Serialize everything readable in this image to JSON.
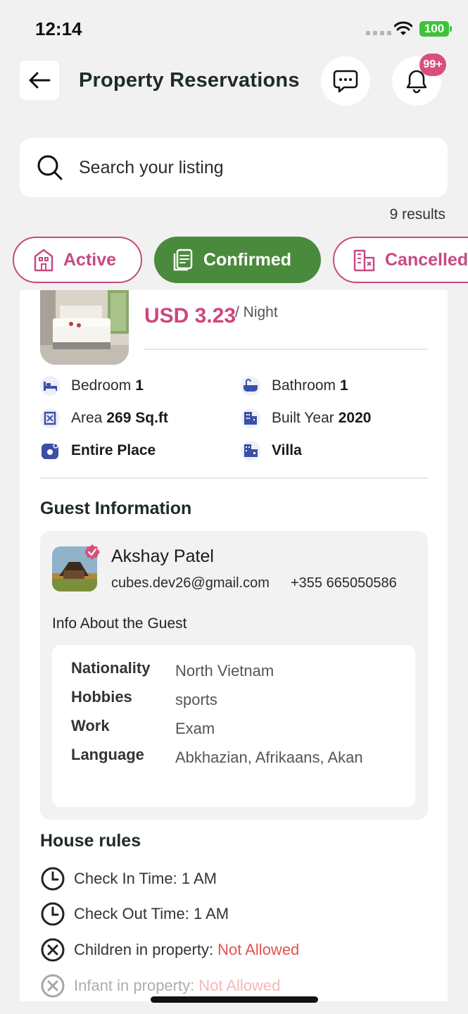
{
  "status_bar": {
    "time": "12:14",
    "battery": "100"
  },
  "header": {
    "title": "Property Reservations",
    "notification_badge": "99+"
  },
  "search": {
    "placeholder": "Search your listing",
    "results": "9 results"
  },
  "tabs": [
    {
      "label": "Active",
      "icon": "building-icon"
    },
    {
      "label": "Confirmed",
      "icon": "document-check-icon"
    },
    {
      "label": "Cancelled",
      "icon": "building-x-icon"
    }
  ],
  "listing": {
    "price": "USD 3.23",
    "per": "/ Night",
    "features": [
      {
        "label": "Bedroom",
        "value": "1",
        "icon": "bed-icon"
      },
      {
        "label": "Bathroom",
        "value": "1",
        "icon": "bathtub-icon"
      },
      {
        "label": "Area",
        "value": "269 Sq.ft",
        "icon": "area-icon"
      },
      {
        "label": "Built Year",
        "value": "2020",
        "icon": "building-year-icon"
      },
      {
        "label": "",
        "value": "Entire Place",
        "icon": "place-icon"
      },
      {
        "label": "",
        "value": "Villa",
        "icon": "villa-icon"
      }
    ]
  },
  "guest": {
    "section_title": "Guest Information",
    "name": "Akshay Patel",
    "email": "cubes.dev26@gmail.com",
    "phone": "+355 665050586",
    "info_title": "Info About the Guest",
    "details": [
      {
        "label": "Nationality",
        "value": "North Vietnam"
      },
      {
        "label": "Hobbies",
        "value": "sports"
      },
      {
        "label": "Work",
        "value": "Exam"
      },
      {
        "label": "Language",
        "value": "Abkhazian, Afrikaans, Akan"
      }
    ]
  },
  "house_rules": {
    "section_title": "House rules",
    "rules": [
      {
        "label": "Check In Time: 1 AM",
        "status": ""
      },
      {
        "label": "Check Out Time: 1 AM",
        "status": ""
      },
      {
        "label": "Children in property:",
        "status": "Not Allowed"
      },
      {
        "label": "Infant in property:",
        "status": "Not Allowed"
      }
    ]
  },
  "colors": {
    "accent": "#c64a83",
    "confirmed": "#4a8a3c",
    "price": "#d0447d",
    "not_allowed": "#e2534d",
    "icon_blue": "#3b4fa8"
  }
}
